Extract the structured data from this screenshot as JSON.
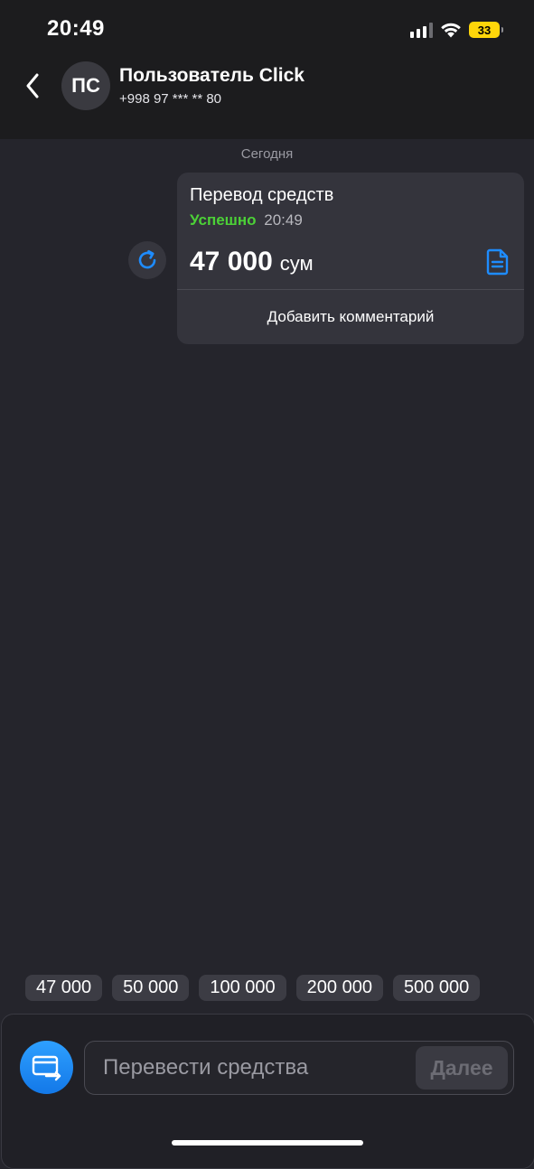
{
  "status_bar": {
    "time": "20:49",
    "battery": "33",
    "icons": [
      "signal-icon",
      "wifi-icon",
      "battery-icon"
    ]
  },
  "header": {
    "avatar_initials": "ПС",
    "name": "Пользователь Click",
    "phone": "+998 97 *** ** 80",
    "back_icon": "chevron-left-icon"
  },
  "chat": {
    "date_label": "Сегодня",
    "message": {
      "title": "Перевод средств",
      "status": "Успешно",
      "time": "20:49",
      "amount": "47 000",
      "currency": "сум",
      "add_comment_label": "Добавить комментарий",
      "status_color": "#4cd137",
      "accent_color": "#1e8cff"
    }
  },
  "quick_amounts": [
    "47 000",
    "50 000",
    "100 000",
    "200 000",
    "500 000"
  ],
  "input_bar": {
    "placeholder": "Перевести средства",
    "value": "",
    "next_label": "Далее"
  }
}
